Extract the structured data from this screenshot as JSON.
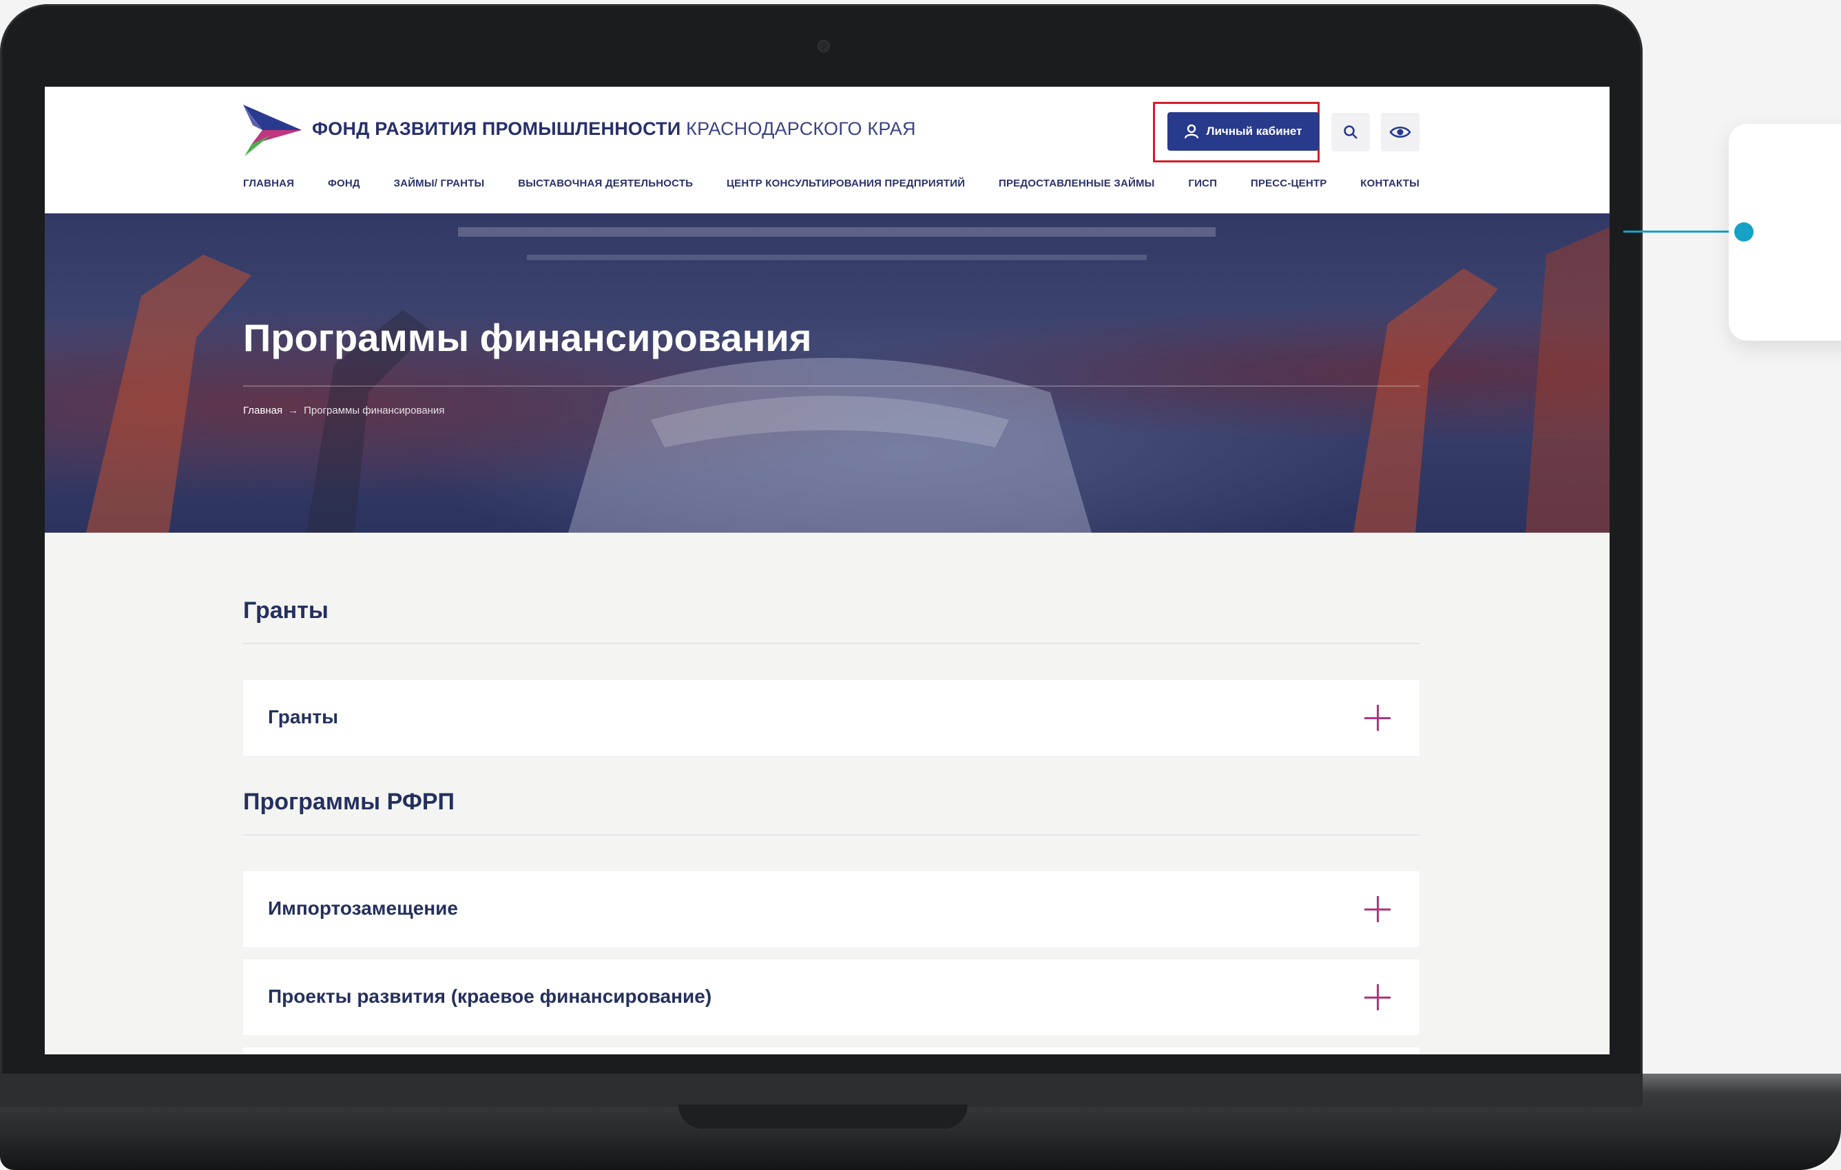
{
  "header": {
    "logo_bold": "ФОНД РАЗВИТИЯ ПРОМЫШЛЕННОСТИ",
    "logo_light": "КРАСНОДАРСКОГО КРАЯ",
    "cabinet_label": "Личный кабинет",
    "search_icon": "search-icon",
    "accessibility_icon": "eye-icon"
  },
  "nav": {
    "items": [
      "ГЛАВНАЯ",
      "ФОНД",
      "ЗАЙМЫ/ ГРАНТЫ",
      "ВЫСТАВОЧНАЯ ДЕЯТЕЛЬНОСТЬ",
      "ЦЕНТР КОНСУЛЬТИРОВАНИЯ ПРЕДПРИЯТИЙ",
      "ПРЕДОСТАВЛЕННЫЕ ЗАЙМЫ",
      "ГИСП",
      "ПРЕСС-ЦЕНТР",
      "КОНТАКТЫ"
    ]
  },
  "hero": {
    "title": "Программы финансирования",
    "breadcrumb_home": "Главная",
    "breadcrumb_sep": "→",
    "breadcrumb_current": "Программы финансирования"
  },
  "sections": [
    {
      "title": "Гранты",
      "items": [
        "Гранты"
      ]
    },
    {
      "title": "Программы РФРП",
      "items": [
        "Импортозамещение",
        "Проекты развития (краевое финансирование)"
      ]
    }
  ],
  "colors": {
    "brand_blue": "#283a8c",
    "text_navy": "#24305e",
    "accent_magenta": "#b0357f",
    "highlight_red": "#d21e2b",
    "connector_cyan": "#14a3c7"
  }
}
